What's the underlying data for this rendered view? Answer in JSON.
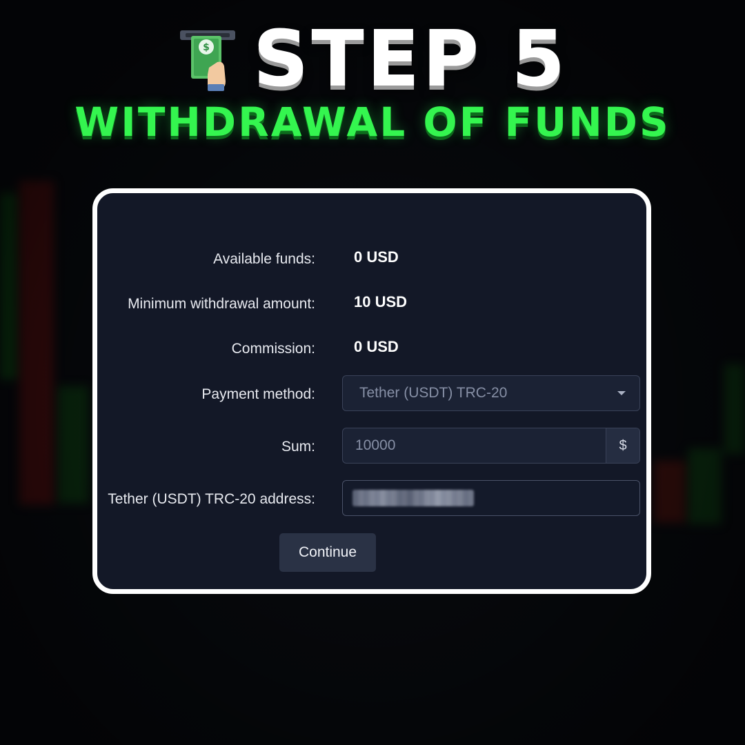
{
  "header": {
    "icon": "atm-cash-withdrawal-icon",
    "step_title": "STEP 5",
    "subtitle": "WITHDRAWAL OF FUNDS"
  },
  "form": {
    "available_funds": {
      "label": "Available funds:",
      "value": "0 USD"
    },
    "minimum_withdrawal": {
      "label": "Minimum withdrawal amount:",
      "value": "10 USD"
    },
    "commission": {
      "label": "Commission:",
      "value": "0 USD"
    },
    "payment_method": {
      "label": "Payment method:",
      "selected": "Tether (USDT) TRC-20"
    },
    "sum": {
      "label": "Sum:",
      "value": "10000",
      "currency_symbol": "$"
    },
    "address": {
      "label": "Tether (USDT) TRC-20 address:"
    },
    "continue_label": "Continue"
  },
  "colors": {
    "panel_bg": "#131827",
    "panel_border": "#ffffff",
    "accent_green": "#34f54f",
    "button_bg": "#2a3245"
  }
}
